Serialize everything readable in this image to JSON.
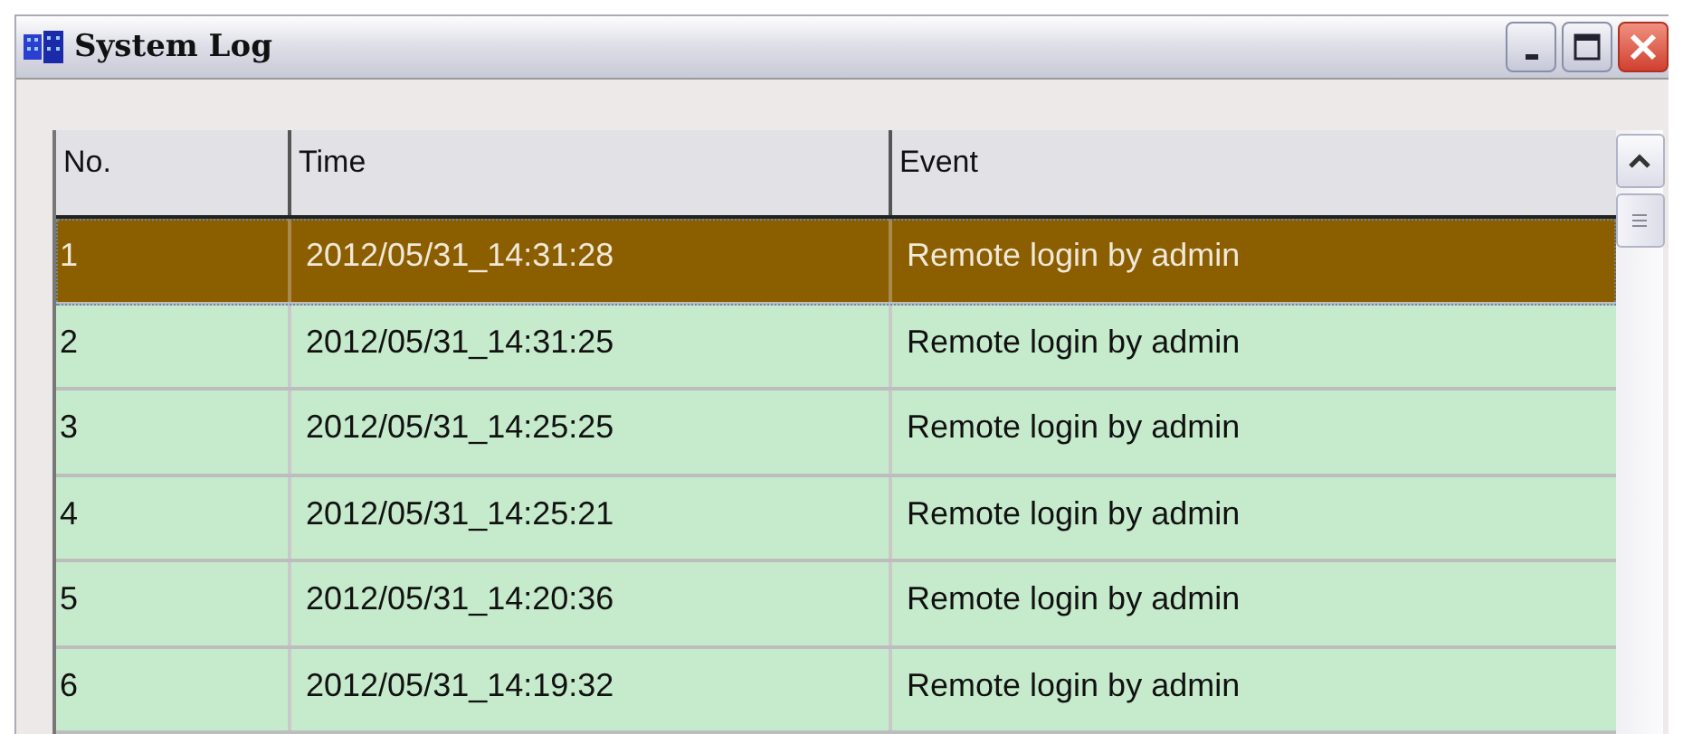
{
  "window": {
    "title": "System Log"
  },
  "table": {
    "columns": [
      "No.",
      "Time",
      "Event"
    ],
    "rows": [
      {
        "cells": [
          "1",
          "2012/05/31_14:31:28",
          "Remote login by admin"
        ],
        "selected": true
      },
      {
        "cells": [
          "2",
          "2012/05/31_14:31:25",
          "Remote login by admin"
        ],
        "selected": false
      },
      {
        "cells": [
          "3",
          "2012/05/31_14:25:25",
          "Remote login by admin"
        ],
        "selected": false
      },
      {
        "cells": [
          "4",
          "2012/05/31_14:25:21",
          "Remote login by admin"
        ],
        "selected": false
      },
      {
        "cells": [
          "5",
          "2012/05/31_14:20:36",
          "Remote login by admin"
        ],
        "selected": false
      },
      {
        "cells": [
          "6",
          "2012/05/31_14:19:32",
          "Remote login by admin"
        ],
        "selected": false
      }
    ]
  }
}
